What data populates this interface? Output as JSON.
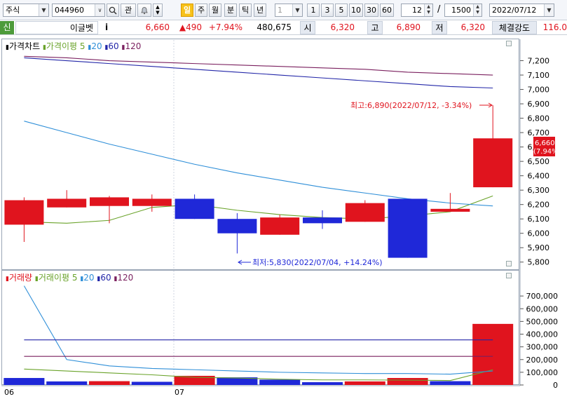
{
  "toolbar": {
    "market": "주식",
    "code": "044960",
    "watch_btn": "관",
    "periods": [
      "일",
      "주",
      "월",
      "분",
      "틱",
      "년"
    ],
    "active_period": "일",
    "unit": "1",
    "intervals": [
      "1",
      "3",
      "5",
      "10",
      "30",
      "60"
    ],
    "page_value": "12",
    "slash": "/",
    "total_value": "1500",
    "date": "2022/07/12"
  },
  "quote": {
    "flag": "신",
    "name": "이글벳",
    "info": "i",
    "price": "6,660",
    "change": "▲490",
    "change_pct": "+7.94%",
    "volume": "480,675",
    "open_label": "시",
    "open": "6,320",
    "high_label": "고",
    "high": "6,890",
    "low_label": "저",
    "low": "6,320",
    "strength_label": "체결강도",
    "strength": "116.0"
  },
  "price_panel": {
    "legend": {
      "title": "가격차트",
      "ma_title": "가격이평",
      "ma_periods": [
        "5",
        "20",
        "60",
        "120"
      ]
    },
    "high_note": "최고:6,890(2022/07/12,  -3.34%)",
    "low_note": "최저:5,830(2022/07/04,  +14.24%)",
    "last_price_tag": "6,660",
    "last_pct_tag": "(7.94%)"
  },
  "volume_panel": {
    "legend": {
      "title": "거래량",
      "ma_title": "거래이평",
      "ma_periods": [
        "5",
        "20",
        "60",
        "120"
      ]
    }
  },
  "x_labels": [
    "06",
    "07"
  ],
  "colors": {
    "up": "#e0141e",
    "down": "#1f28d8",
    "ma5": "#6aa32a",
    "ma20": "#2f8fd8",
    "ma60": "#2226a8",
    "ma120": "#7a1f5e"
  },
  "chart_data": [
    {
      "type": "candlestick",
      "title": "가격차트",
      "ylim": [
        5750,
        7300
      ],
      "yticks": [
        5800,
        5900,
        6000,
        6100,
        6200,
        6300,
        6400,
        6500,
        6600,
        6700,
        6800,
        6900,
        7000,
        7100,
        7200
      ],
      "candles": [
        {
          "open": 6060,
          "high": 6250,
          "low": 5940,
          "close": 6230
        },
        {
          "open": 6180,
          "high": 6300,
          "low": 6180,
          "close": 6240
        },
        {
          "open": 6190,
          "high": 6260,
          "low": 6070,
          "close": 6250
        },
        {
          "open": 6190,
          "high": 6270,
          "low": 6150,
          "close": 6240
        },
        {
          "open": 6240,
          "high": 6270,
          "low": 6100,
          "close": 6100
        },
        {
          "open": 6100,
          "high": 6140,
          "low": 5860,
          "close": 6000
        },
        {
          "open": 5990,
          "high": 6130,
          "low": 5990,
          "close": 6110
        },
        {
          "open": 6110,
          "high": 6160,
          "low": 6030,
          "close": 6070
        },
        {
          "open": 6080,
          "high": 6230,
          "low": 6080,
          "close": 6210
        },
        {
          "open": 6240,
          "high": 6240,
          "low": 5830,
          "close": 5830
        },
        {
          "open": 6150,
          "high": 6280,
          "low": 6150,
          "close": 6170
        },
        {
          "open": 6320,
          "high": 6890,
          "low": 6320,
          "close": 6660
        }
      ],
      "series": [
        {
          "name": "5",
          "values": [
            6080,
            6070,
            6090,
            6180,
            6200,
            6160,
            6130,
            6110,
            6100,
            6120,
            6150,
            6260
          ]
        },
        {
          "name": "20",
          "values": [
            6780,
            6700,
            6620,
            6550,
            6480,
            6420,
            6370,
            6320,
            6280,
            6240,
            6210,
            6190
          ]
        },
        {
          "name": "60",
          "values": [
            7220,
            7200,
            7180,
            7160,
            7140,
            7120,
            7100,
            7080,
            7060,
            7040,
            7020,
            7010
          ]
        },
        {
          "name": "120",
          "values": [
            7230,
            7220,
            7200,
            7190,
            7180,
            7170,
            7160,
            7150,
            7140,
            7120,
            7110,
            7100
          ]
        }
      ]
    },
    {
      "type": "bar",
      "title": "거래량",
      "ylim": [
        0,
        800000
      ],
      "yticks": [
        0,
        100000,
        200000,
        300000,
        400000,
        500000,
        600000,
        700000
      ],
      "ytick_labels": [
        "0",
        "100,000",
        "200,000",
        "300,000",
        "400,000",
        "500,000",
        "600,000",
        "700,000"
      ],
      "values": [
        55000,
        28000,
        30000,
        25000,
        72000,
        60000,
        42000,
        22000,
        28000,
        55000,
        30000,
        480675
      ],
      "directions": [
        "down",
        "down",
        "up",
        "down",
        "up",
        "down",
        "down",
        "down",
        "up",
        "up",
        "down",
        "up"
      ],
      "series": [
        {
          "name": "5",
          "values": [
            125000,
            110000,
            95000,
            80000,
            60000,
            55000,
            45000,
            40000,
            40000,
            38000,
            35000,
            120000
          ]
        },
        {
          "name": "20",
          "values": [
            780000,
            200000,
            150000,
            130000,
            120000,
            110000,
            100000,
            95000,
            90000,
            90000,
            85000,
            110000
          ]
        },
        {
          "name": "60",
          "values": [
            355000,
            355000,
            355000,
            355000,
            355000,
            355000,
            355000,
            355000,
            355000,
            355000,
            355000,
            355000
          ]
        },
        {
          "name": "120",
          "values": [
            225000,
            225000,
            225000,
            225000,
            225000,
            225000,
            225000,
            225000,
            225000,
            225000,
            225000,
            225000
          ]
        }
      ]
    }
  ]
}
